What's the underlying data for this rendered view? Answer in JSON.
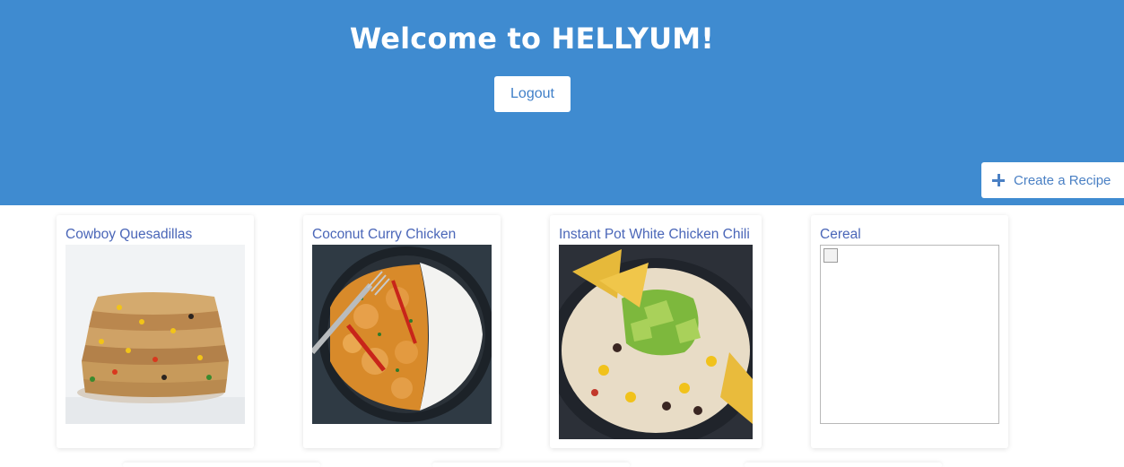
{
  "header": {
    "title": "Welcome to HELLYUM!",
    "logout_label": "Logout",
    "create_label": "Create a Recipe",
    "bg_color": "#3f8bd0"
  },
  "recipes": [
    {
      "name": "Cowboy Quesadillas",
      "image": "quesadilla-photo"
    },
    {
      "name": "Coconut Curry Chicken",
      "image": "curry-photo"
    },
    {
      "name": "Instant Pot White Chicken Chili",
      "image": "chili-photo"
    },
    {
      "name": "Cereal",
      "image": "broken-image-icon"
    }
  ]
}
